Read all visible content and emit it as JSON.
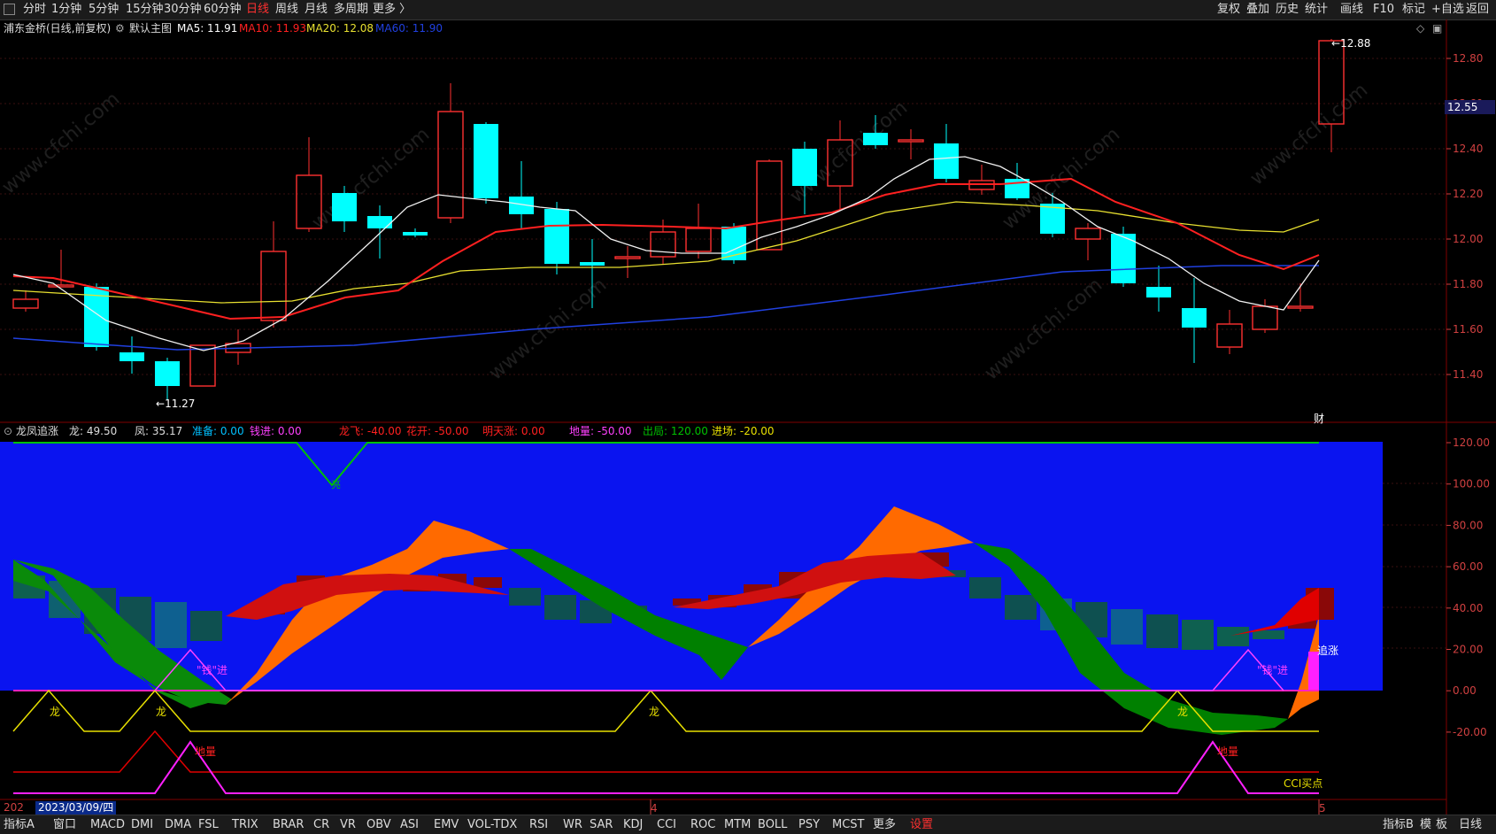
{
  "toolbar": {
    "periods": [
      "分时",
      "1分钟",
      "5分钟",
      "15分钟",
      "30分钟",
      "60分钟",
      "日线",
      "周线",
      "月线",
      "多周期",
      "更多 〉"
    ],
    "active_period": "日线",
    "right_tools": [
      "复权",
      "叠加",
      "历史",
      "统计",
      "画线",
      "F10",
      "标记",
      "+自选",
      "返回"
    ]
  },
  "main_info": {
    "stock": "浦东金桥(日线,前复权)",
    "template": "默认主图",
    "ma5": "MA5: 11.91",
    "ma10": "MA10: 11.93",
    "ma20": "MA20: 12.08",
    "ma60": "MA60: 11.90"
  },
  "price_axis": [
    "12.80",
    "12.60",
    "12.40",
    "12.20",
    "12.00",
    "11.80",
    "11.60",
    "11.40"
  ],
  "current_price": "12.55",
  "high_label": "12.88",
  "low_label": "11.27",
  "cai_label": "财",
  "indicator_info": {
    "name": "龙凤追涨",
    "long": "龙: 49.50",
    "feng": "凤: 35.17",
    "zhunbei": "准备: 0.00",
    "qianjin": "钱进: 0.00",
    "longfei": "龙飞: -40.00",
    "huakai": "花开: -50.00",
    "mingtian": "明天涨: 0.00",
    "diliang": "地量: -50.00",
    "chuju": "出局: 120.00",
    "jinchang": "进场: -20.00"
  },
  "indicator_axis": [
    "120.00",
    "100.00",
    "80.00",
    "60.00",
    "40.00",
    "20.00",
    "0.00",
    "-20.00"
  ],
  "indicator_labels": {
    "liang": "亮",
    "long": "龙",
    "zhuizhang": "追涨",
    "qian_jin": "\"钱\"进",
    "diliang": "地量",
    "cci": "CCI买点"
  },
  "cursor_date": "2023/03/09/四",
  "year_prefix": "202",
  "bottom_tabs": [
    "指标A",
    "窗口",
    "MACD",
    "DMI",
    "DMA",
    "FSL",
    "TRIX",
    "BRAR",
    "CR",
    "VR",
    "OBV",
    "ASI",
    "EMV",
    "VOL-TDX",
    "RSI",
    "WR",
    "SAR",
    "KDJ",
    "CCI",
    "ROC",
    "MTM",
    "BOLL",
    "PSY",
    "MCST",
    "更多",
    "设置"
  ],
  "bottom_right": [
    "指标B",
    "模",
    "板",
    "日线"
  ],
  "watermark": "www.cfchi.com",
  "colors": {
    "up": "#ff3030",
    "down": "#00ffff",
    "ma5": "#ffffff",
    "ma10": "#ff2020",
    "ma20": "#e8e030",
    "ma60": "#2040e0",
    "indicator_bg": "#0a14f0"
  }
}
